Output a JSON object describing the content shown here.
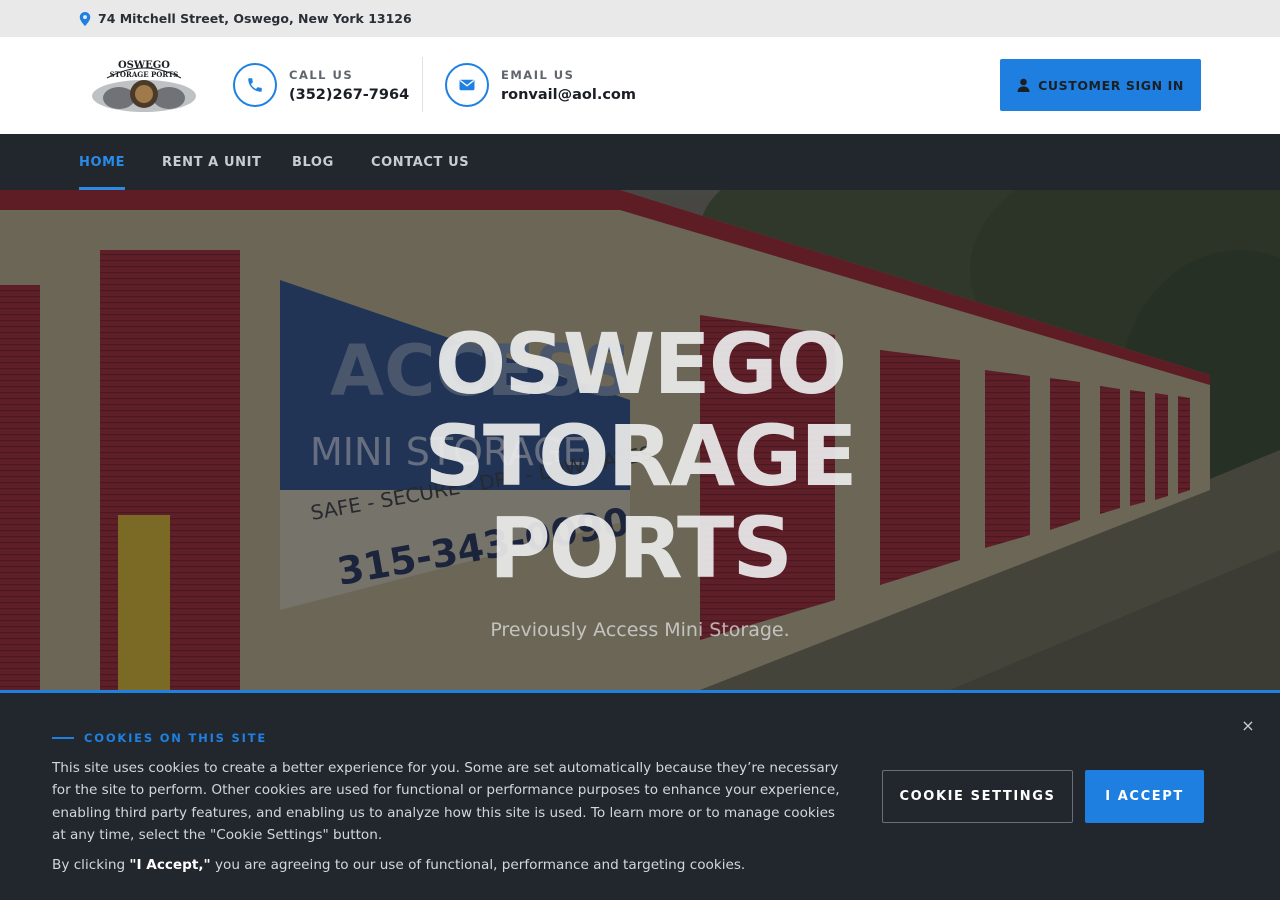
{
  "topbar": {
    "address": "74 Mitchell Street, Oswego, New York 13126"
  },
  "header": {
    "logo_text": "OSWEGO STORAGE PORTS",
    "call": {
      "label": "CALL US",
      "value": "(352)267-7964"
    },
    "email": {
      "label": "EMAIL US",
      "value": "ronvail@aol.com"
    },
    "signin_label": "CUSTOMER SIGN IN"
  },
  "nav": {
    "items": [
      {
        "label": "HOME"
      },
      {
        "label": "RENT A UNIT"
      },
      {
        "label": "BLOG"
      },
      {
        "label": "CONTACT US"
      }
    ]
  },
  "hero": {
    "title_line1": "OSWEGO",
    "title_line2": "STORAGE",
    "title_line3": "PORTS",
    "subtitle": "Previously Access Mini Storage.",
    "sign_text_1": "ACCESS",
    "sign_text_2": "MINI STORAGE",
    "sign_text_3": "SAFE - SECURE - DRY - LOW RATES",
    "sign_text_4": "315-343-0090"
  },
  "cookie": {
    "heading": "COOKIES ON THIS SITE",
    "body": "This site uses cookies to create a better experience for you. Some are set automatically because they’re necessary for the site to perform. Other cookies are used for functional or performance purposes to enhance your experience, enabling third party features, and enabling us to analyze how this site is used. To learn more or to manage cookies at any time, select the \"Cookie Settings\" button.",
    "body2_prefix": "By clicking ",
    "body2_bold": "\"I Accept,\"",
    "body2_suffix": " you are agreeing to our use of functional, performance and targeting cookies.",
    "settings_label": "COOKIE SETTINGS",
    "accept_label": "I ACCEPT",
    "close_glyph": "×"
  },
  "colors": {
    "accent": "#1e80e0",
    "nav_bg": "#22272d",
    "topbar_bg": "#e9e9ea"
  }
}
